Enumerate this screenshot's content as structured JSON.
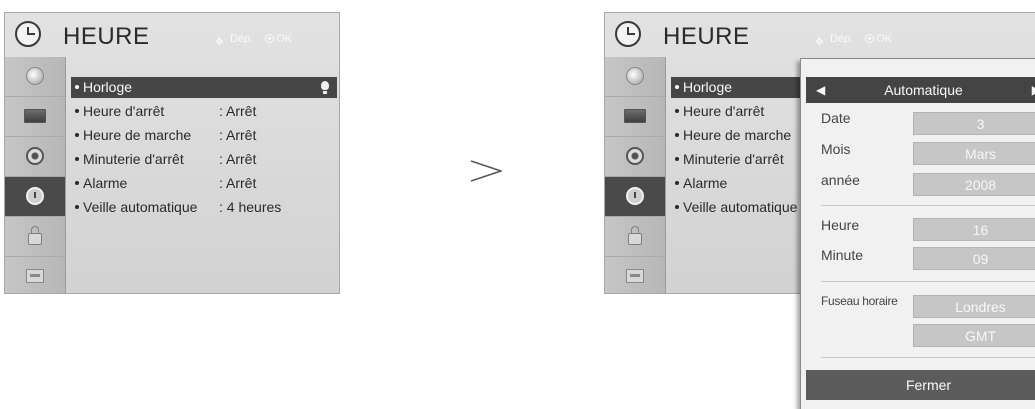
{
  "menu": {
    "title": "HEURE",
    "hint_move": "Dép.",
    "hint_ok": "OK",
    "sidebar_icons": [
      "satellite-icon",
      "tv-icon",
      "audio-icon",
      "clock-icon",
      "lock-icon",
      "option-icon"
    ],
    "items": [
      {
        "label": "Horloge",
        "value": ""
      },
      {
        "label": "Heure d'arrêt",
        "value": ": Arrêt"
      },
      {
        "label": "Heure de marche",
        "value": ": Arrêt"
      },
      {
        "label": "Minuterie d'arrêt",
        "value": ": Arrêt"
      },
      {
        "label": "Alarme",
        "value": ": Arrêt"
      },
      {
        "label": "Veille automatique",
        "value": ": 4 heures"
      }
    ]
  },
  "popup": {
    "mode": "Automatique",
    "date_label": "Date",
    "date_value": "3",
    "month_label": "Mois",
    "month_value": "Mars",
    "year_label": "année",
    "year_value": "2008",
    "hour_label": "Heure",
    "hour_value": "16",
    "minute_label": "Minute",
    "minute_value": "09",
    "timezone_label": "Fuseau horaire",
    "timezone_value": "Londres",
    "timezone_offset": "GMT",
    "close_label": "Fermer"
  },
  "colors": {
    "selected_bg": "#464646",
    "menu_bg": "#dadada",
    "value_box": "#c6c6c6"
  }
}
